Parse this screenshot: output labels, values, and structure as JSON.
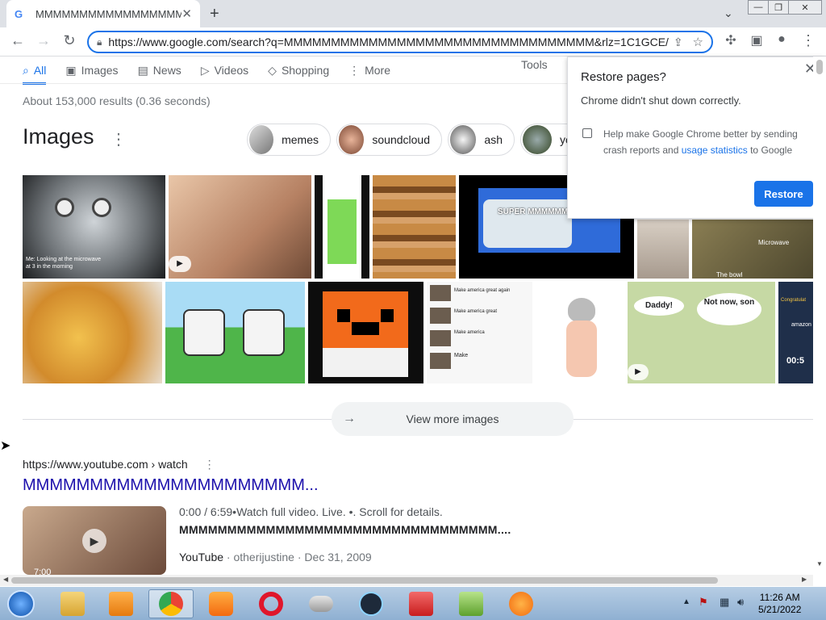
{
  "browser": {
    "tab_title": "MMMMMMMMMMMMMMMMM",
    "tab_favicon": "G",
    "new_tab": "+",
    "url": "https://www.google.com/search?q=MMMMMMMMMMMMMMMMMMMMMMMMMMMMMMMMM&rlz=1C1GCE/",
    "window_buttons": [
      "—",
      "❐",
      "✕"
    ]
  },
  "google": {
    "tabs": [
      {
        "label": "All",
        "icon": "search-icon"
      },
      {
        "label": "Images",
        "icon": "image-icon"
      },
      {
        "label": "News",
        "icon": "news-icon"
      },
      {
        "label": "Videos",
        "icon": "video-icon"
      },
      {
        "label": "Shopping",
        "icon": "tag-icon"
      },
      {
        "label": "More",
        "icon": "dots-icon"
      }
    ],
    "tools": "Tools",
    "stats": "About 153,000 results (0.36 seconds)",
    "images_heading": "Images",
    "chips": [
      "memes",
      "soundcloud",
      "ash",
      "yo"
    ],
    "thumb_captions": {
      "t1": "Me: Looking at the microwave at 3 in the morning",
      "t5": "SUPER MMMMMMMMM",
      "t7a": "Microwave",
      "t7b": "The bowl",
      "t11a": "Make america great again",
      "t11b": "Make america great",
      "t11c": "Make america",
      "t11d": "Make",
      "t13a": "Daddy!",
      "t13b": "Not now, son",
      "t14a": "Congratulat",
      "t14b": "amazon",
      "t14c": "00:5"
    },
    "view_more": "View more images",
    "result": {
      "source": "https://www.youtube.com › watch",
      "title": "MMMMMMMMMMMMMMMMMMMMM...",
      "desc": "0:00 / 6:59•Watch full video. Live. •. Scroll for details.",
      "desc2": "MMMMMMMMMMMMMMMMMMMMMMMMMMMMMMMMM....",
      "meta_site": "YouTube",
      "meta_channel": "otherijustine",
      "meta_date": "Dec 31, 2009",
      "duration": "7:00"
    }
  },
  "restore_popup": {
    "title": "Restore pages?",
    "message": "Chrome didn't shut down correctly.",
    "checkbox_text_1": "Help make Google Chrome better by sending crash reports and ",
    "checkbox_link": "usage statistics",
    "checkbox_text_2": " to Google",
    "restore_button": "Restore"
  },
  "taskbar": {
    "clock_time": "11:26 AM",
    "clock_date": "5/21/2022"
  }
}
